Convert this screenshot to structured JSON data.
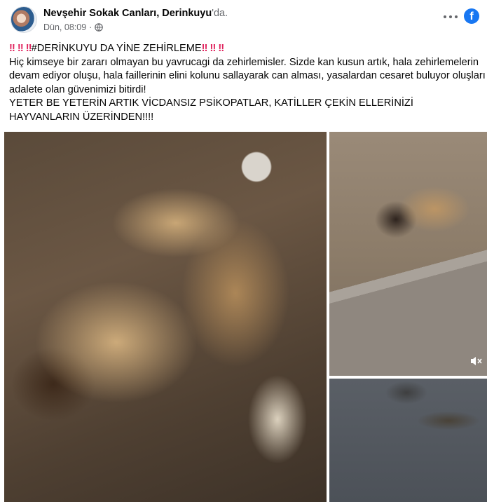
{
  "post": {
    "author": "Nevşehir Sokak Canları",
    "separator": ",",
    "location": "Derinkuyu",
    "location_suffix": "'da.",
    "timestamp": "Dün, 08:09",
    "dot": "·",
    "privacy_icon": "globe-icon",
    "more_icon": "more-options-icon",
    "brand_icon": "facebook-logo-icon",
    "brand_letter": "f",
    "brand_color": "#1877f2"
  },
  "content": {
    "emoji": "‼",
    "hashtag_line": "#DERİNKUYU DA YİNE ZEHİRLEME",
    "paragraph": "Hiç kimseye bir zararı olmayan bu yavrucagi da zehirlemisler. Sizde kan kusun artık, hala zehirlemelerin devam ediyor oluşu, hala faillerinin elini kolunu sallayarak can alması, yasalardan cesaret buluyor oluşları adalete olan güvenimizi bitirdi!",
    "caps_line": "YETER BE YETERİN ARTIK VİCDANSIZ PSİKOPATLAR, KATİLLER ÇEKİN ELLERİNİZİ HAYVANLARIN ÜZERİNDEN!!!!"
  },
  "media": {
    "photos": [
      "photo-1",
      "photo-2",
      "photo-3"
    ],
    "video_control": "volume-mute-icon"
  }
}
